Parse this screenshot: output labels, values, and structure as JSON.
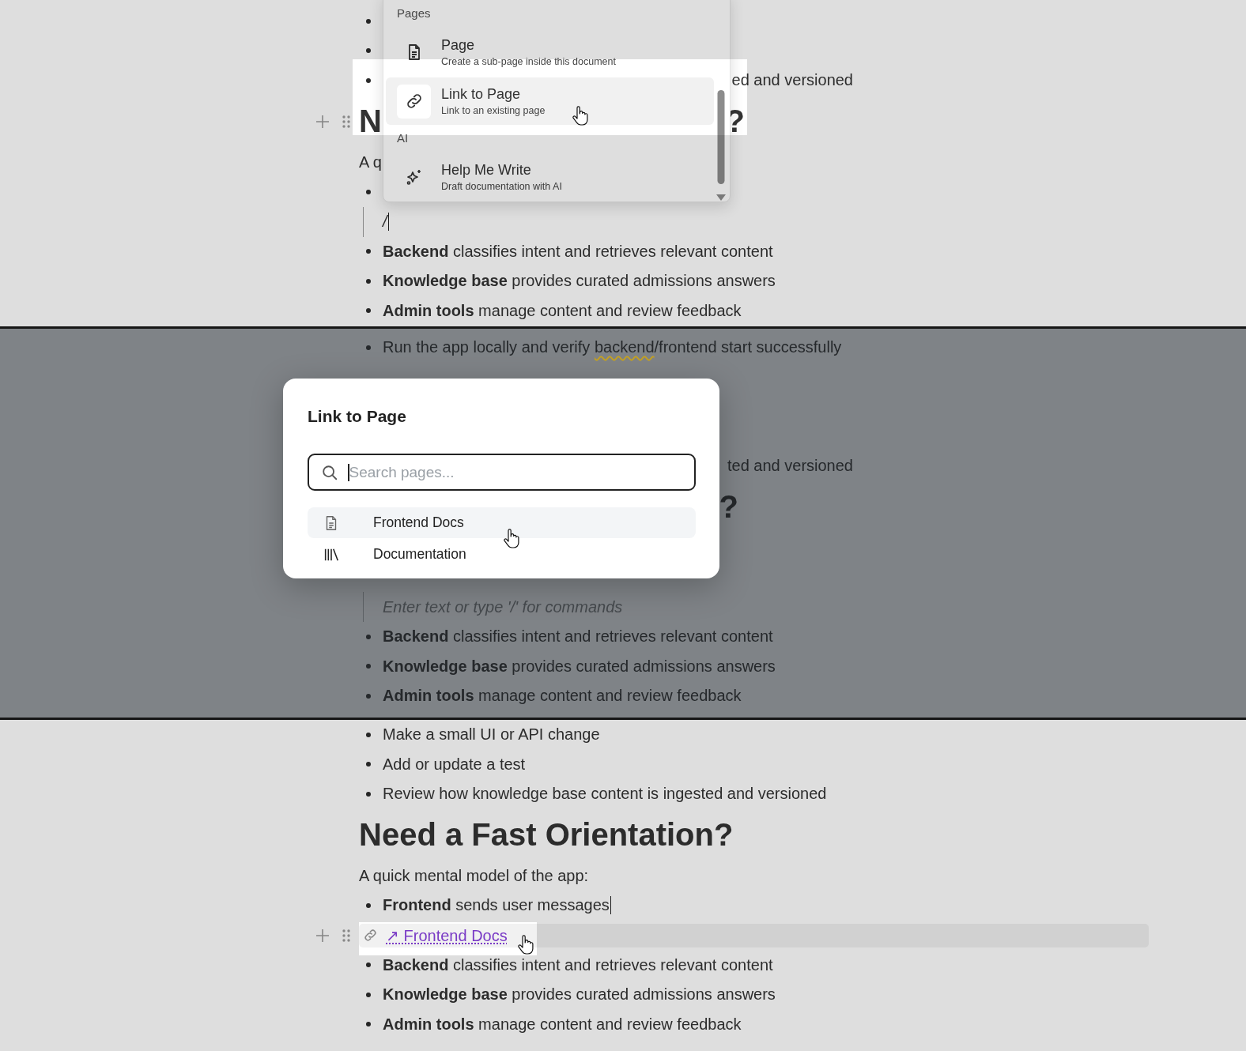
{
  "slash_menu_step": {
    "blocks": [
      {
        "kind": "bullet"
      },
      {
        "kind": "bullet"
      },
      {
        "kind": "bullet_tail",
        "text": "ed and versioned"
      },
      {
        "kind": "heading_clipped",
        "start": "N",
        "end": "?",
        "hovered": true
      },
      {
        "kind": "paragraph",
        "text": "A q"
      },
      {
        "kind": "bullet"
      },
      {
        "kind": "slash",
        "text": "/",
        "caret": true
      },
      {
        "kind": "bullet",
        "text": "**Backend** classifies intent and retrieves relevant content",
        "caret": false
      },
      {
        "kind": "bullet",
        "text": "**Knowledge base** provides curated admissions answers",
        "caret": false
      },
      {
        "kind": "bullet",
        "text": "**Admin tools** manage content and review feedback",
        "caret": false
      }
    ],
    "menu": {
      "groups": [
        {
          "label": "Pages",
          "items": [
            {
              "kind": "page",
              "title": "Page",
              "description": "Create a sub-page inside this document",
              "selected": false
            },
            {
              "kind": "link",
              "title": "Link to Page",
              "description": "Link to an existing page",
              "selected": true
            }
          ]
        },
        {
          "label": "AI",
          "items": [
            {
              "kind": "sparkle",
              "title": "Help Me Write",
              "description": "Draft documentation with AI",
              "selected": false
            }
          ]
        }
      ]
    }
  },
  "link_dialog_step": {
    "blocks_top": [
      {
        "kind": "bullet",
        "parts": [
          {
            "text": "Run the app locally and verify ",
            "flagged": false
          },
          {
            "text": "backend",
            "flagged": true
          },
          {
            "text": "/frontend start successfully",
            "flagged": false
          }
        ],
        "caret": false
      }
    ],
    "blocks_middle": [
      {
        "kind": "line_tail",
        "text": "ted and versioned"
      },
      {
        "kind": "heading_clipped",
        "end": "?"
      }
    ],
    "blocks_bottom": [
      {
        "kind": "placeholder",
        "placeholder": "Enter text or type '/' for commands"
      },
      {
        "kind": "bullet",
        "text": "**Backend** classifies intent and retrieves relevant content",
        "caret": false
      },
      {
        "kind": "bullet",
        "text": "**Knowledge base** provides curated admissions answers",
        "caret": false
      },
      {
        "kind": "bullet",
        "text": "**Admin tools** manage content and review feedback",
        "caret": false
      }
    ],
    "dialog": {
      "title": "Link to Page",
      "search": {
        "placeholder": "Search pages...",
        "focused": true
      },
      "results": [
        {
          "kind": "page",
          "label": "Frontend Docs",
          "selected": true
        },
        {
          "kind": "collection",
          "label": "Documentation",
          "selected": false
        }
      ]
    }
  },
  "inserted_link_step": {
    "blocks": [
      {
        "kind": "bullet",
        "text": "Make a small UI or API change",
        "caret": false
      },
      {
        "kind": "bullet",
        "text": "Add or update a test",
        "caret": false
      },
      {
        "kind": "bullet",
        "text": "Review how knowledge base content is ingested and versioned",
        "caret": false
      },
      {
        "kind": "heading",
        "text": "Need a Fast Orientation?"
      },
      {
        "kind": "paragraph",
        "text": "A quick mental model of the app:"
      },
      {
        "kind": "bullet",
        "text": "**Frontend** sends user messages",
        "caret": true
      },
      {
        "kind": "link",
        "text": "↗ Frontend Docs",
        "hovered": true
      },
      {
        "kind": "bullet",
        "text": "**Backend** classifies intent and retrieves relevant content",
        "caret": false
      },
      {
        "kind": "bullet",
        "text": "**Knowledge base** provides curated admissions answers",
        "caret": false
      },
      {
        "kind": "bullet",
        "text": "**Admin tools** manage content and review feedback",
        "caret": false
      }
    ]
  }
}
